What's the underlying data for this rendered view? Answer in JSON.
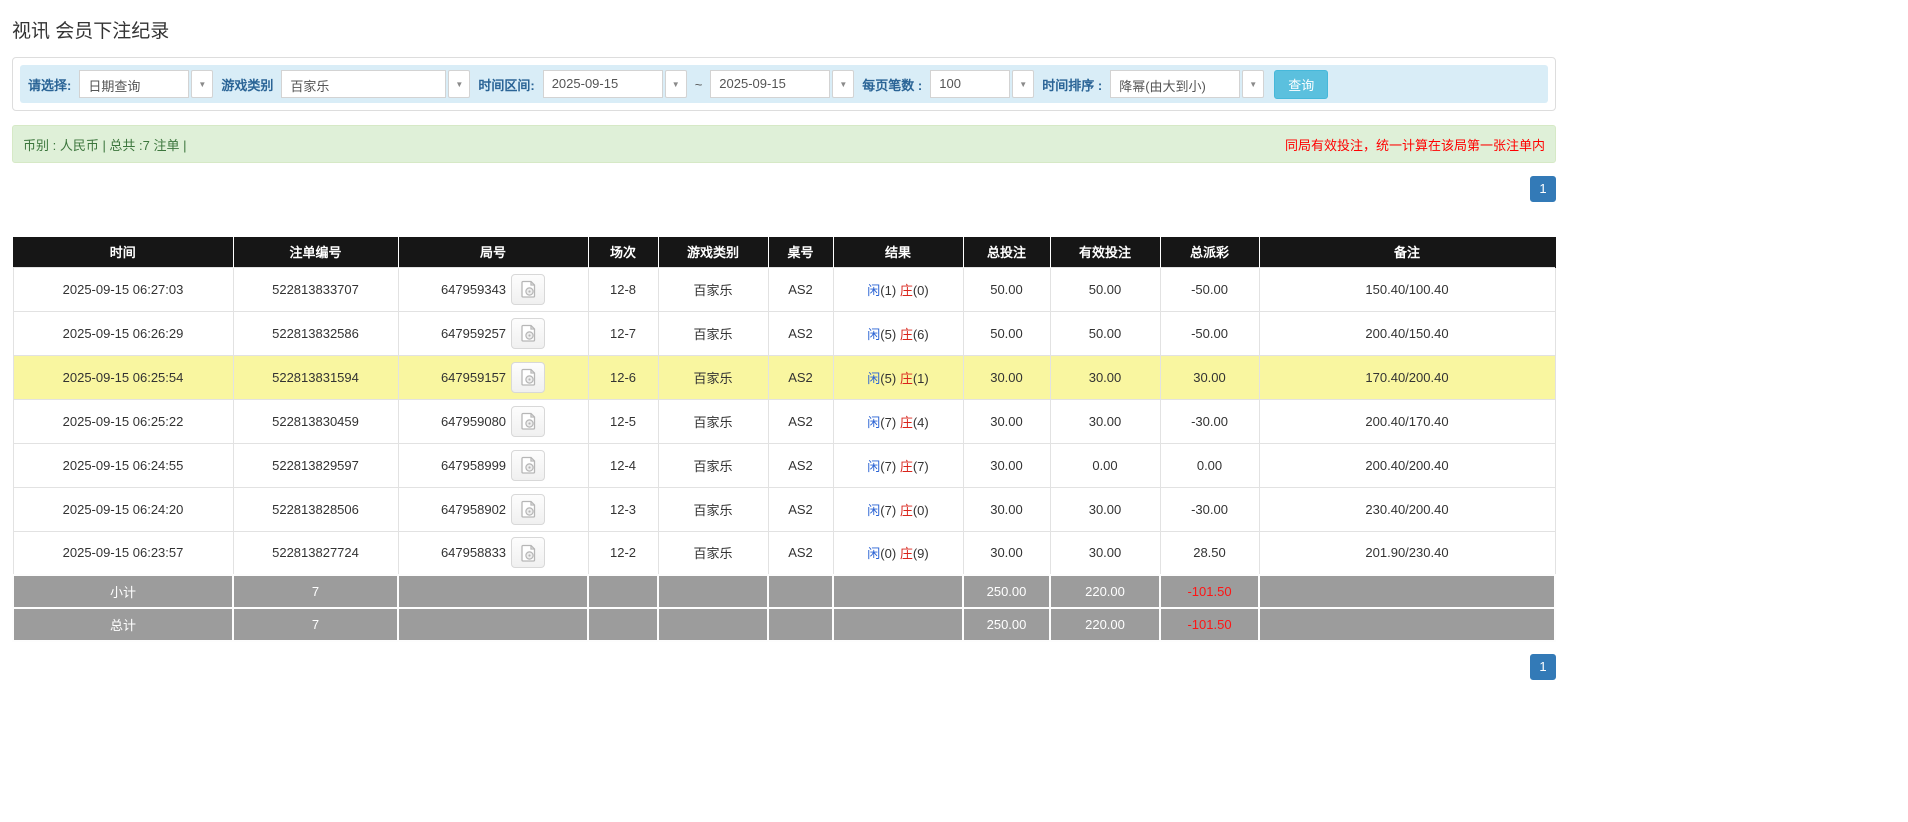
{
  "page": {
    "title": "视讯 会员下注纪录"
  },
  "filters": {
    "select_label": "请选择:",
    "select_value": "日期查询",
    "game_label": "游戏类别",
    "game_value": "百家乐",
    "range_label": "时间区间:",
    "range_from": "2025-09-15",
    "range_tilde": "~",
    "range_to": "2025-09-15",
    "page_size_label": "每页笔数 :",
    "page_size_value": "100",
    "sort_label": "时间排序 :",
    "sort_value": "降幂(由大到小)",
    "search_button": "查询"
  },
  "summary": {
    "left": "币别 : 人民币 | 总共 :7 注单 |",
    "right_note": "同局有效投注，统一计算在该局第一张注单内"
  },
  "pagination": {
    "page": "1"
  },
  "colors": {
    "accent_blue": "#337ab7",
    "filter_bg": "#d9edf7",
    "summary_bg": "#dff0d8",
    "header_bg": "#161616",
    "highlight_row": "#f9f6a0",
    "xian_blue": "#2a63d4",
    "zhuang_red": "#d9251c",
    "negative_red": "#ff0000",
    "subtotal_gray": "#9c9c9c",
    "button_cyan": "#5bc0de"
  },
  "table": {
    "headers": [
      "时间",
      "注单编号",
      "局号",
      "场次",
      "游戏类别",
      "桌号",
      "结果",
      "总投注",
      "有效投注",
      "总派彩",
      "备注"
    ],
    "video_icon": "video-record-icon",
    "rows": [
      {
        "time": "2025-09-15 06:27:03",
        "bet_id": "522813833707",
        "round": "647959343",
        "session": "12-8",
        "game": "百家乐",
        "table_no": "AS2",
        "xian_label": "闲",
        "xian_count": "(1)",
        "zhuang_label": "庄",
        "zhuang_count": "(0)",
        "total_bet": "50.00",
        "valid_bet": "50.00",
        "payout": "-50.00",
        "remark": "150.40/100.40",
        "highlight": false
      },
      {
        "time": "2025-09-15 06:26:29",
        "bet_id": "522813832586",
        "round": "647959257",
        "session": "12-7",
        "game": "百家乐",
        "table_no": "AS2",
        "xian_label": "闲",
        "xian_count": "(5)",
        "zhuang_label": "庄",
        "zhuang_count": "(6)",
        "total_bet": "50.00",
        "valid_bet": "50.00",
        "payout": "-50.00",
        "remark": "200.40/150.40",
        "highlight": false
      },
      {
        "time": "2025-09-15 06:25:54",
        "bet_id": "522813831594",
        "round": "647959157",
        "session": "12-6",
        "game": "百家乐",
        "table_no": "AS2",
        "xian_label": "闲",
        "xian_count": "(5)",
        "zhuang_label": "庄",
        "zhuang_count": "(1)",
        "total_bet": "30.00",
        "valid_bet": "30.00",
        "payout": "30.00",
        "remark": "170.40/200.40",
        "highlight": true
      },
      {
        "time": "2025-09-15 06:25:22",
        "bet_id": "522813830459",
        "round": "647959080",
        "session": "12-5",
        "game": "百家乐",
        "table_no": "AS2",
        "xian_label": "闲",
        "xian_count": "(7)",
        "zhuang_label": "庄",
        "zhuang_count": "(4)",
        "total_bet": "30.00",
        "valid_bet": "30.00",
        "payout": "-30.00",
        "remark": "200.40/170.40",
        "highlight": false
      },
      {
        "time": "2025-09-15 06:24:55",
        "bet_id": "522813829597",
        "round": "647958999",
        "session": "12-4",
        "game": "百家乐",
        "table_no": "AS2",
        "xian_label": "闲",
        "xian_count": "(7)",
        "zhuang_label": "庄",
        "zhuang_count": "(7)",
        "total_bet": "30.00",
        "valid_bet": "0.00",
        "payout": "0.00",
        "remark": "200.40/200.40",
        "highlight": false
      },
      {
        "time": "2025-09-15 06:24:20",
        "bet_id": "522813828506",
        "round": "647958902",
        "session": "12-3",
        "game": "百家乐",
        "table_no": "AS2",
        "xian_label": "闲",
        "xian_count": "(7)",
        "zhuang_label": "庄",
        "zhuang_count": "(0)",
        "total_bet": "30.00",
        "valid_bet": "30.00",
        "payout": "-30.00",
        "remark": "230.40/200.40",
        "highlight": false
      },
      {
        "time": "2025-09-15 06:23:57",
        "bet_id": "522813827724",
        "round": "647958833",
        "session": "12-2",
        "game": "百家乐",
        "table_no": "AS2",
        "xian_label": "闲",
        "xian_count": "(0)",
        "zhuang_label": "庄",
        "zhuang_count": "(9)",
        "total_bet": "30.00",
        "valid_bet": "30.00",
        "payout": "28.50",
        "remark": "201.90/230.40",
        "highlight": false
      }
    ],
    "subtotal": {
      "label": "小计",
      "count": "7",
      "total_bet": "250.00",
      "valid_bet": "220.00",
      "payout": "-101.50"
    },
    "total": {
      "label": "总计",
      "count": "7",
      "total_bet": "250.00",
      "valid_bet": "220.00",
      "payout": "-101.50"
    }
  }
}
